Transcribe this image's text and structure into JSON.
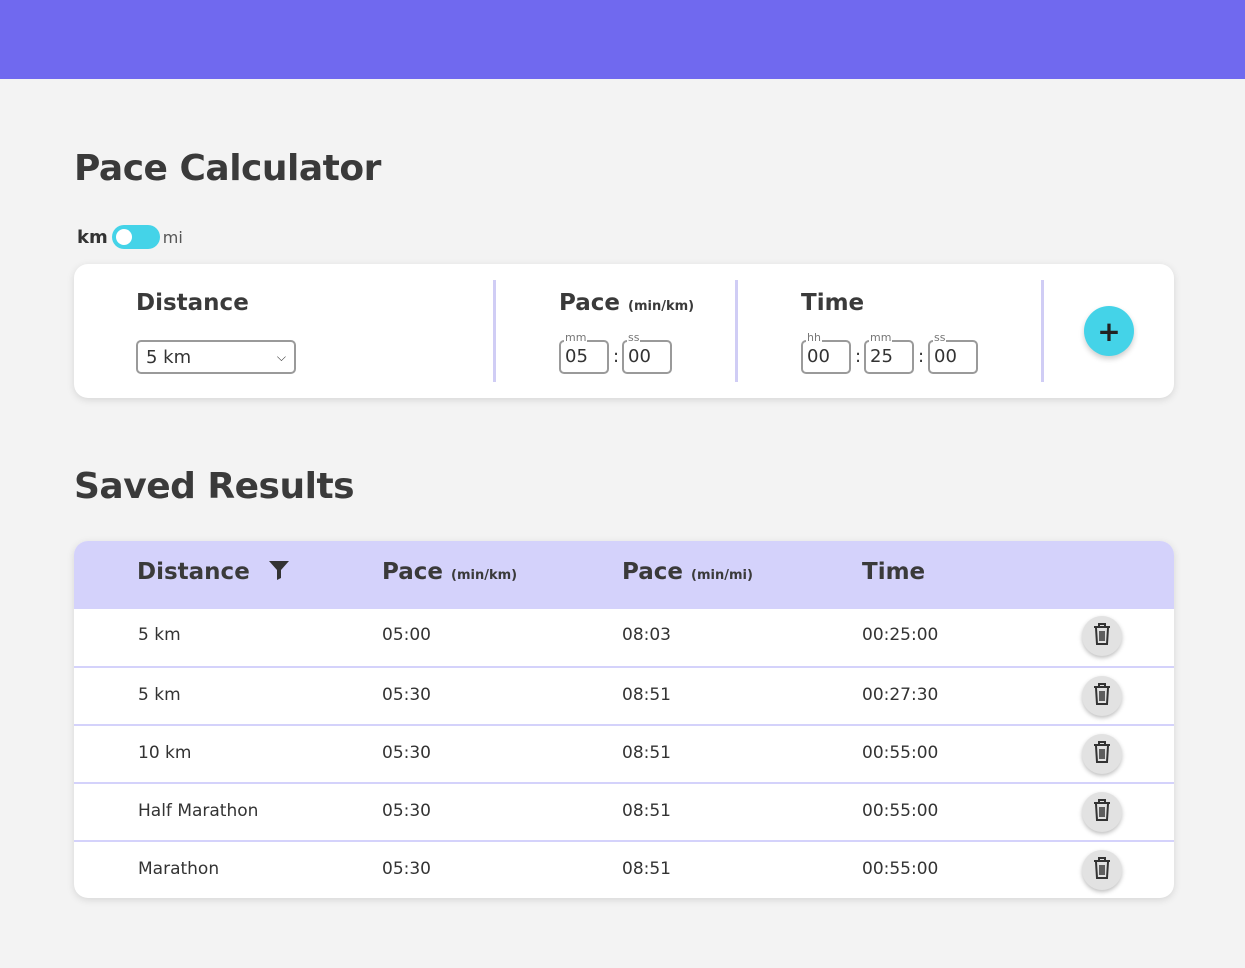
{
  "calculator": {
    "title": "Pace Calculator",
    "unit_toggle": {
      "left_label": "km",
      "right_label": "mi",
      "selected": "km"
    },
    "distance": {
      "label": "Distance",
      "selected": "5 km"
    },
    "pace": {
      "label": "Pace",
      "unit": "(min/km)",
      "mm_label": "mm",
      "mm": "05",
      "ss_label": "ss",
      "ss": "00"
    },
    "time": {
      "label": "Time",
      "hh_label": "hh",
      "hh": "00",
      "mm_label": "mm",
      "mm": "25",
      "ss_label": "ss",
      "ss": "00"
    },
    "add_label": "+",
    "colon": ":"
  },
  "saved": {
    "title": "Saved Results",
    "columns": {
      "distance": "Distance",
      "pace_km": "Pace",
      "pace_km_unit": "(min/km)",
      "pace_mi": "Pace",
      "pace_mi_unit": "(min/mi)",
      "time": "Time"
    },
    "rows": [
      {
        "distance": "5 km",
        "pace_km": "05:00",
        "pace_mi": "08:03",
        "time": "00:25:00"
      },
      {
        "distance": "5 km",
        "pace_km": "05:30",
        "pace_mi": "08:51",
        "time": "00:27:30"
      },
      {
        "distance": "10 km",
        "pace_km": "05:30",
        "pace_mi": "08:51",
        "time": "00:55:00"
      },
      {
        "distance": "Half Marathon",
        "pace_km": "05:30",
        "pace_mi": "08:51",
        "time": "00:55:00"
      },
      {
        "distance": "Marathon",
        "pace_km": "05:30",
        "pace_mi": "08:51",
        "time": "00:55:00"
      }
    ]
  },
  "colors": {
    "header": "#7069ef",
    "accent": "#44d3e8",
    "table_header": "#d4d2fb",
    "divider": "#d0cdf5"
  },
  "icons": {
    "filter": "filter-icon",
    "delete": "trash-icon",
    "add": "plus-icon",
    "dropdown": "chevron-down-icon"
  }
}
